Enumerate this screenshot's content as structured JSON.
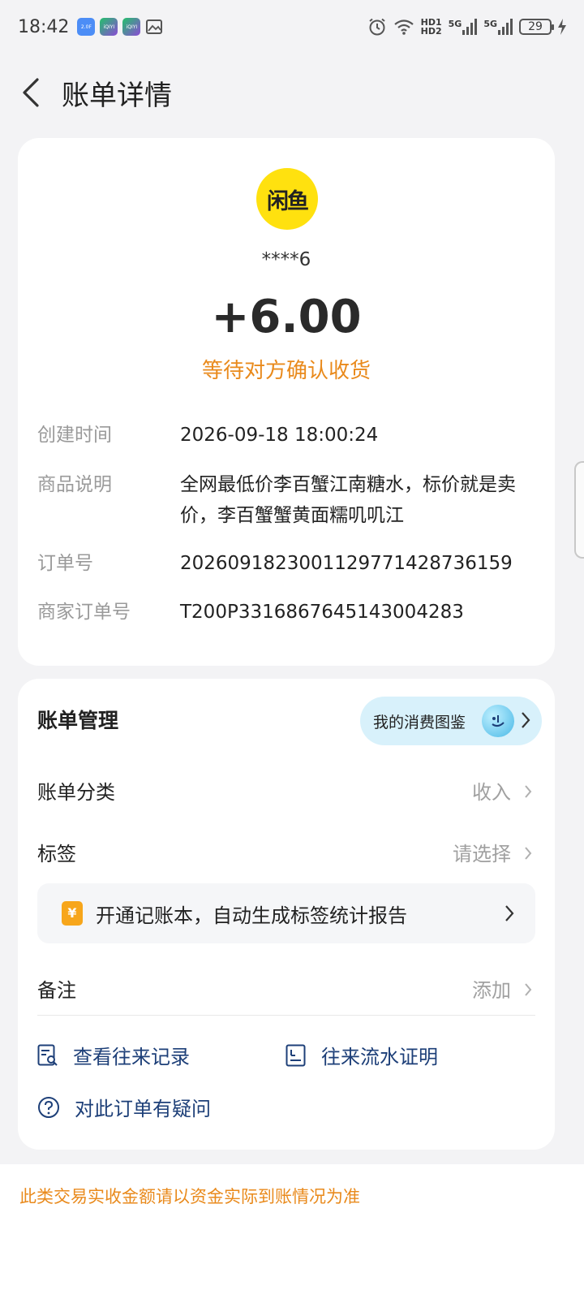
{
  "status_bar": {
    "time": "18:42",
    "app_icon_1": "2.0F",
    "app_icon_2": "iQIYI",
    "app_icon_3": "iQIYI",
    "hd_top": "HD1",
    "hd_bottom": "HD2",
    "network_1": "5G",
    "network_2": "5G",
    "battery": "29"
  },
  "header": {
    "title": "账单详情"
  },
  "transaction": {
    "merchant_logo_text": "闲鱼",
    "payee": "****6",
    "amount": "+6.00",
    "status": "等待对方确认收货",
    "status_color": "#e98a1c",
    "details": [
      {
        "label": "创建时间",
        "value": "2026-09-18 18:00:24"
      },
      {
        "label": "商品说明",
        "value": "全网最低价李百蟹江南糖水，标价就是卖价，李百蟹蟹黄面糯叽叽江"
      },
      {
        "label": "订单号",
        "value": "2026091823001129771428736159"
      },
      {
        "label": "商家订单号",
        "value": "T200P3316867645143004283"
      }
    ]
  },
  "management": {
    "title": "账单管理",
    "consume_pill": "我的消费图鉴",
    "category": {
      "label": "账单分类",
      "value": "收入"
    },
    "tag": {
      "label": "标签",
      "value": "请选择"
    },
    "promo": {
      "icon_text": "¥",
      "text": "开通记账本，自动生成标签统计报告"
    },
    "note": {
      "label": "备注",
      "value": "添加"
    },
    "links": {
      "history": "查看往来记录",
      "flow_proof": "往来流水证明",
      "question": "对此订单有疑问"
    }
  },
  "footer": {
    "note": "此类交易实收金额请以资金实际到账情况为准"
  }
}
